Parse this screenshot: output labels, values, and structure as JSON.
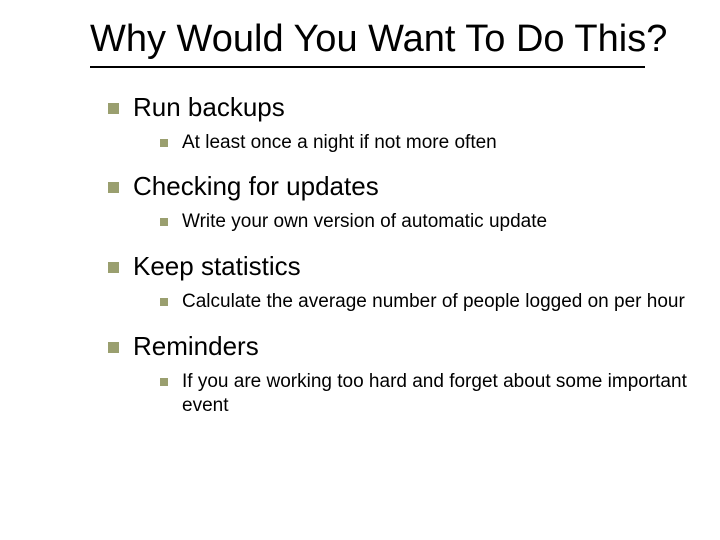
{
  "title": "Why Would You Want To Do This?",
  "items": [
    {
      "label": "Run backups",
      "sub": "At least once a night if not more often"
    },
    {
      "label": "Checking for updates",
      "sub": "Write your own version of automatic update"
    },
    {
      "label": "Keep statistics",
      "sub": "Calculate the average number of people logged on per hour"
    },
    {
      "label": "Reminders",
      "sub": "If you are working too hard and forget about some important event"
    }
  ]
}
